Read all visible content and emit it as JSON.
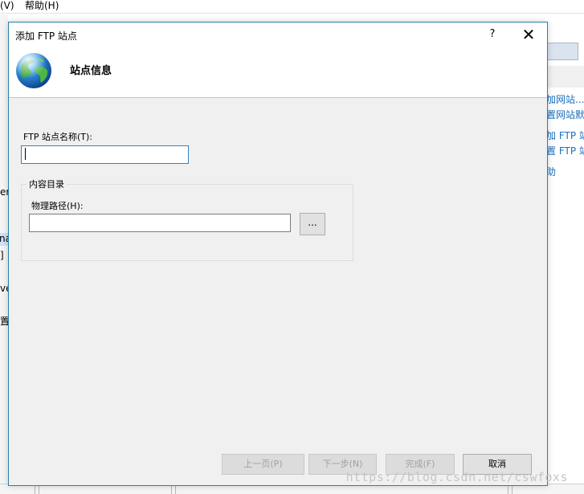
{
  "background_app": {
    "menu": [
      "(V)",
      "帮助(H)"
    ],
    "left_fragments": [
      "er",
      "na",
      "]",
      "ve",
      "置"
    ],
    "right_actions": [
      "加网站...",
      "置网站默",
      "加 FTP 站",
      "置 FTP 站",
      "助"
    ]
  },
  "dialog": {
    "title": "添加 FTP 站点",
    "help_label": "?",
    "close_label": "✕",
    "heading": "站点信息",
    "header_icon": "globe-icon",
    "site_name_label": "FTP 站点名称(T):",
    "site_name_value": "",
    "content_dir_label": "内容目录",
    "physical_path_label": "物理路径(H):",
    "physical_path_value": "",
    "browse_label": "...",
    "buttons": {
      "prev": "上一页(P)",
      "next": "下一步(N)",
      "finish": "完成(F)",
      "cancel": "取消"
    }
  },
  "watermark": "https://blog.csdn.net/cswfoxs",
  "colors": {
    "dialog_border": "#2b7fa8",
    "dialog_bg": "#f0f0f0",
    "link_blue": "#1a6fbf"
  }
}
